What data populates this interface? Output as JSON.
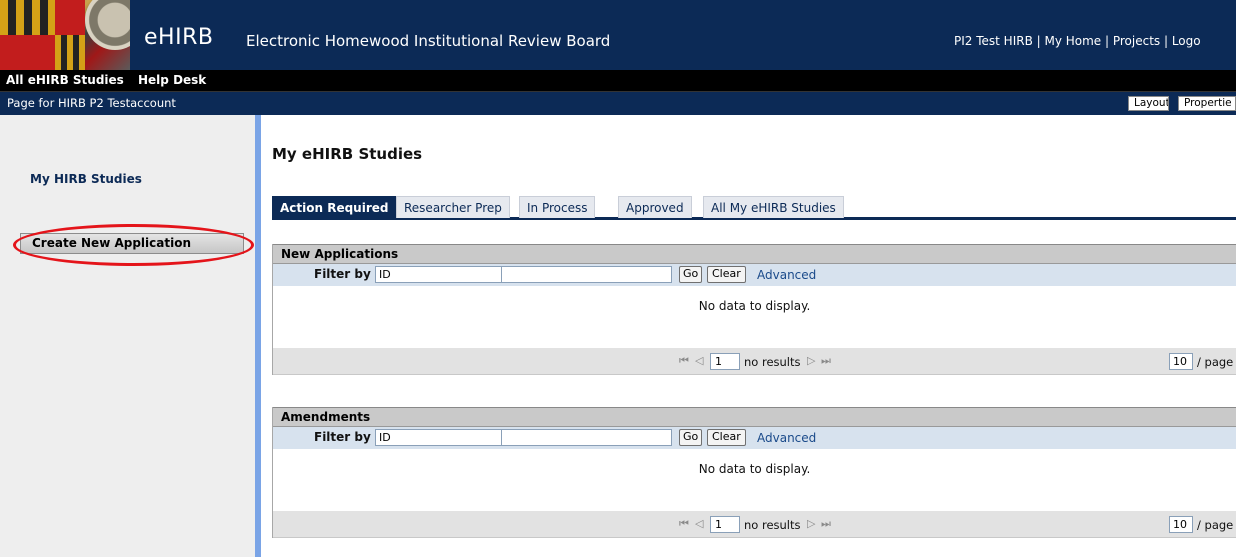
{
  "header": {
    "brand": "eHIRB",
    "subtitle": "Electronic Homewood Institutional Review Board",
    "top_links": "PI2 Test HIRB | My Home | Projects | Logo"
  },
  "navbar": {
    "items": [
      "All eHIRB Studies",
      "Help Desk"
    ]
  },
  "pagebar": {
    "label": "Page for HIRB P2 Testaccount",
    "buttons": [
      "Layout",
      "Propertie"
    ]
  },
  "sidebar": {
    "section_title": "My HIRB Studies",
    "create_button": "Create New Application"
  },
  "main": {
    "title": "My eHIRB Studies",
    "tabs": [
      {
        "label": "Action Required",
        "active": true
      },
      {
        "label": "Researcher Prep",
        "active": false
      },
      {
        "label": "In Process",
        "active": false
      },
      {
        "label": "Approved",
        "active": false
      },
      {
        "label": "All My eHIRB Studies",
        "active": false
      }
    ],
    "panels": [
      {
        "title": "New Applications",
        "filter_label": "Filter by",
        "filter_field": "ID",
        "go_label": "Go",
        "clear_label": "Clear",
        "advanced_label": "Advanced",
        "empty_message": "No data to display.",
        "page_value": "1",
        "page_status": "no results",
        "per_page_value": "10",
        "per_page_label": "/ page"
      },
      {
        "title": "Amendments",
        "filter_label": "Filter by",
        "filter_field": "ID",
        "go_label": "Go",
        "clear_label": "Clear",
        "advanced_label": "Advanced",
        "empty_message": "No data to display.",
        "page_value": "1",
        "page_status": "no results",
        "per_page_value": "10",
        "per_page_label": "/ page"
      }
    ]
  },
  "colors": {
    "header_navy": "#0c2a56",
    "accent_blue": "#7aa4e6",
    "highlight_red": "#e4141a"
  }
}
